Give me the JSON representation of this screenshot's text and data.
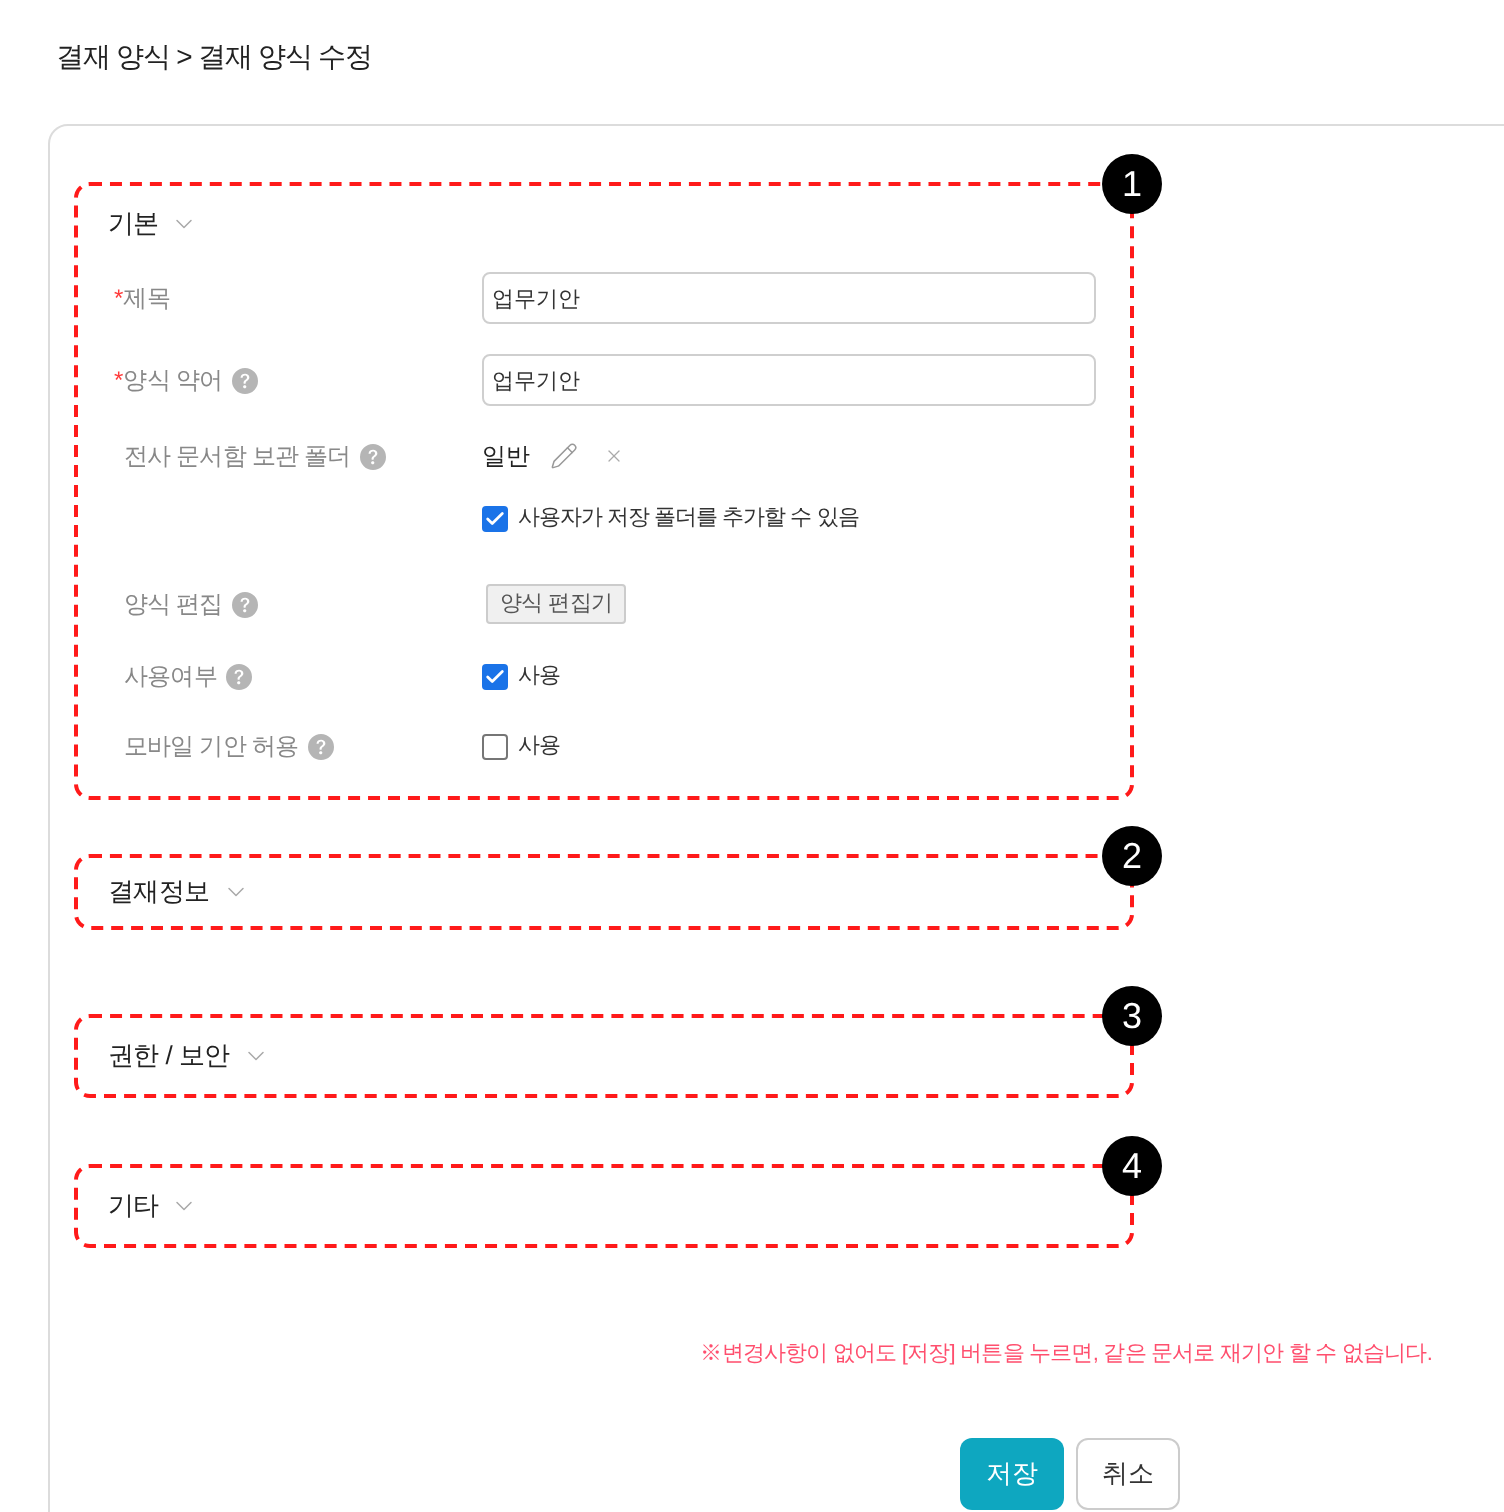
{
  "breadcrumb": "결재 양식 > 결재 양식 수정",
  "sections": [
    {
      "title": "기본",
      "marker": "1",
      "fields": [
        {
          "kind": "input",
          "mark": "*",
          "label": "제목",
          "help": false,
          "value": "업무기안"
        },
        {
          "kind": "input",
          "mark": "*",
          "label": "양식 약어",
          "help": true,
          "value": "업무기안"
        },
        {
          "kind": "folder",
          "label": "전사 문서함 보관 폴더",
          "help": true,
          "value": "일반",
          "option": {
            "label": "사용자가 저장 폴더를 추가할 수 있음",
            "checked": true
          }
        },
        {
          "kind": "button",
          "label": "양식 편집",
          "help": true,
          "button": "양식 편집기"
        },
        {
          "kind": "checkbox",
          "label": "사용여부",
          "help": true,
          "option": {
            "label": "사용",
            "checked": true
          }
        },
        {
          "kind": "checkbox",
          "label": "모바일 기안 허용",
          "help": true,
          "option": {
            "label": "사용",
            "checked": false
          }
        }
      ]
    },
    {
      "title": "결재정보",
      "marker": "2"
    },
    {
      "title": "권한 / 보안",
      "marker": "3"
    },
    {
      "title": "기타",
      "marker": "4"
    }
  ],
  "notice": "※변경사항이 없어도 [저장] 버튼을 누르면, 같은 문서로 재기안 할 수 없습니다.",
  "buttons": [
    {
      "label": "저장",
      "kind": "primary"
    },
    {
      "label": "취소",
      "kind": "secondary"
    }
  ]
}
